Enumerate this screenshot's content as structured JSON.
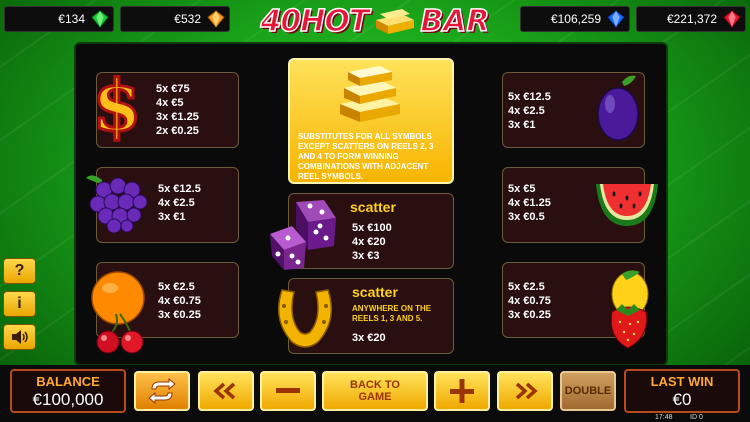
{
  "jackpots": [
    {
      "value": "€134",
      "gem": "green-gem-icon",
      "color": "#19c93a"
    },
    {
      "value": "€532",
      "gem": "orange-gem-icon",
      "color": "#ff9b1a"
    },
    {
      "value": "€106,259",
      "gem": "blue-gem-icon",
      "color": "#1a6aff"
    },
    {
      "value": "€221,372",
      "gem": "red-gem-icon",
      "color": "#e8152a"
    }
  ],
  "logo": {
    "part1": "40HOT",
    "part2": "BAR"
  },
  "paytable": {
    "dollar": [
      "5x €75",
      "4x €5",
      "3x €1.25",
      "2x €0.25"
    ],
    "grapes": [
      "5x €12.5",
      "4x €2.5",
      "3x €1"
    ],
    "orange_cherry": [
      "5x €2.5",
      "4x €0.75",
      "3x €0.25"
    ],
    "plum": [
      "5x €12.5",
      "4x €2.5",
      "3x €1"
    ],
    "watermelon": [
      "5x €5",
      "4x €1.25",
      "3x €0.5"
    ],
    "strawberry": [
      "5x €2.5",
      "4x €0.75",
      "3x €0.25"
    ],
    "wild_text": "SUBSTITUTES FOR ALL SYMBOLS EXCEPT SCATTERS ON REELS 2, 3 AND 4 TO FORM WINNING COMBINATIONS WITH ADJACENT REEL SYMBOLS.",
    "dice_title": "scatter",
    "dice": [
      "5x €100",
      "4x €20",
      "3x €3"
    ],
    "horseshoe_title": "scatter",
    "horseshoe_note": "ANYWHERE ON THE REELS 1, 3 AND 5.",
    "horseshoe_pay": "3x €20"
  },
  "side_buttons": {
    "help": "?",
    "info": "i"
  },
  "bottom": {
    "balance_label": "BALANCE",
    "balance_value": "€100,000",
    "back_label": "BACK TO GAME",
    "double_label": "DOUBLE",
    "last_win_label": "LAST WIN",
    "last_win_value": "€0",
    "time": "17:48",
    "id": "ID 0"
  }
}
